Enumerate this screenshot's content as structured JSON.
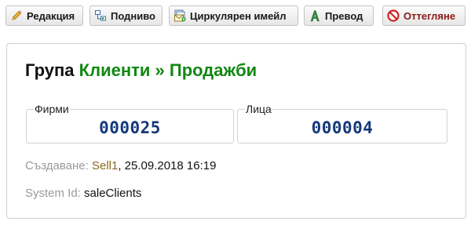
{
  "toolbar": {
    "edit": {
      "label": "Редакция",
      "icon": "pencil-icon"
    },
    "subgroup": {
      "label": "Подниво",
      "icon": "tree-icon"
    },
    "circular_email": {
      "label": "Циркулярен имейл",
      "icon": "email-icon"
    },
    "translation": {
      "label": "Превод",
      "icon": "translate-icon"
    },
    "reject": {
      "label": "Оттегляне",
      "icon": "reject-icon",
      "color": "#cc2222"
    }
  },
  "group": {
    "prefix": "Група",
    "name": "Клиенти » Продажби",
    "name_color": "#118811"
  },
  "stats": {
    "firms": {
      "label": "Фирми",
      "value": "000025"
    },
    "persons": {
      "label": "Лица",
      "value": "000004"
    }
  },
  "meta": {
    "created_label": "Създаване:",
    "created_by": "Sell1",
    "created_at": ", 25.09.2018 16:19",
    "system_id_label": "System Id:",
    "system_id": "saleClients"
  }
}
